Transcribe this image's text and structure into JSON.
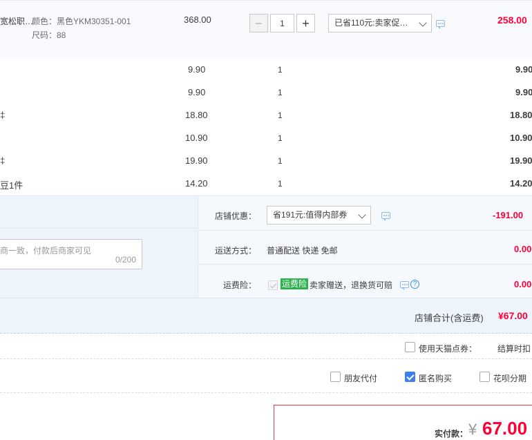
{
  "top_item": {
    "title_fragment": "宽松职…",
    "sku_color": "颜色：黑色YKM30351-001",
    "sku_size": "尺码：88",
    "price": "368.00",
    "quantity": "1",
    "promo_selected": "已省110元:卖家促…",
    "subtotal": "258.00"
  },
  "items": [
    {
      "name_fragment": "",
      "price": "9.90",
      "qty": "1",
      "subtotal": "9.90"
    },
    {
      "name_fragment": "",
      "price": "9.90",
      "qty": "1",
      "subtotal": "9.90"
    },
    {
      "name_fragment": "‡",
      "price": "18.80",
      "qty": "1",
      "subtotal": "18.80"
    },
    {
      "name_fragment": "",
      "price": "10.90",
      "qty": "1",
      "subtotal": "10.90"
    },
    {
      "name_fragment": "‡",
      "price": "19.90",
      "qty": "1",
      "subtotal": "19.90"
    },
    {
      "name_fragment": "豆1件",
      "price": "14.20",
      "qty": "1",
      "subtotal": "14.20"
    }
  ],
  "shop": {
    "discount_label": "店铺优惠：",
    "discount_selected": "省191元:值得内部券",
    "discount_value": "-191.00",
    "memo_placeholder": "商一致，付款后商家可见",
    "memo_count": "0/200",
    "shipping_label": "运送方式：",
    "shipping_value": "普通配送 快递 免邮",
    "shipping_fee": "0.00",
    "insurance_label": "运费险：",
    "insurance_badge": "运费险",
    "insurance_text": "卖家赠送，退换货可赔",
    "insurance_fee": "0.00",
    "total_label": "店铺合计(含运费)",
    "total_value": "¥67.00"
  },
  "options": {
    "coupon_label": "使用天猫点券：",
    "settle_label": "结算时扣",
    "friend_pay_label": "朋友代付",
    "anonymous_label": "匿名购买",
    "huabei_label": "花呗分期"
  },
  "payment": {
    "label": "实付款：",
    "currency": "¥",
    "amount": "67.00"
  },
  "colors": {
    "accent_red": "#ff0036",
    "checkbox_blue": "#3d80ec",
    "insurance_green": "#2bb24c"
  }
}
